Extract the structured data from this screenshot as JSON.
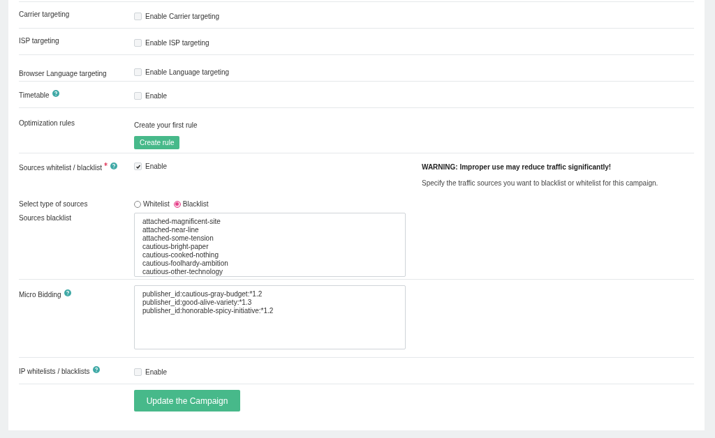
{
  "rows": [
    {
      "kind": "checkbox",
      "label": "Carrier targeting",
      "help": false,
      "required": false,
      "checked": false,
      "text": "Enable Carrier targeting"
    },
    {
      "kind": "checkbox",
      "label": "ISP targeting",
      "help": false,
      "required": false,
      "checked": false,
      "text": "Enable ISP targeting"
    },
    {
      "kind": "checkbox",
      "label": "Browser Language targeting",
      "help": false,
      "required": false,
      "checked": false,
      "text": "Enable Language targeting"
    },
    {
      "kind": "checkbox",
      "label": "Timetable",
      "help": true,
      "required": false,
      "checked": false,
      "text": "Enable"
    },
    {
      "kind": "rule",
      "label": "Optimization rules",
      "help": false,
      "required": false,
      "text": "Create your first rule",
      "button": "Create rule"
    },
    {
      "kind": "sources",
      "label": "Sources whitelist / blacklist",
      "help": true,
      "required": true,
      "checked": true,
      "text": "Enable",
      "warning": "WARNING: Improper use may reduce traffic significantly!",
      "note": "Specify the traffic sources you want to blacklist or whitelist for this campaign.",
      "type_label": "Select type of sources",
      "options": [
        {
          "label": "Whitelist",
          "selected": false
        },
        {
          "label": "Blacklist",
          "selected": true
        }
      ],
      "list_label": "Sources blacklist",
      "list_value": "attached-magnificent-site\nattached-near-line\nattached-some-tension\ncautious-bright-paper\ncautious-cooked-nothing\ncautious-foolhardy-ambition\ncautious-other-technology"
    },
    {
      "kind": "textarea",
      "label": "Micro Bidding",
      "help": true,
      "required": false,
      "value": "publisher_id:cautious-gray-budget:*1.2\npublisher_id:good-alive-variety:*1.3\npublisher_id:honorable-spicy-initiative:*1.2"
    },
    {
      "kind": "checkbox",
      "label": "IP whitelists / blacklists",
      "help": true,
      "required": false,
      "checked": false,
      "text": "Enable"
    }
  ],
  "submit": "Update the Campaign"
}
